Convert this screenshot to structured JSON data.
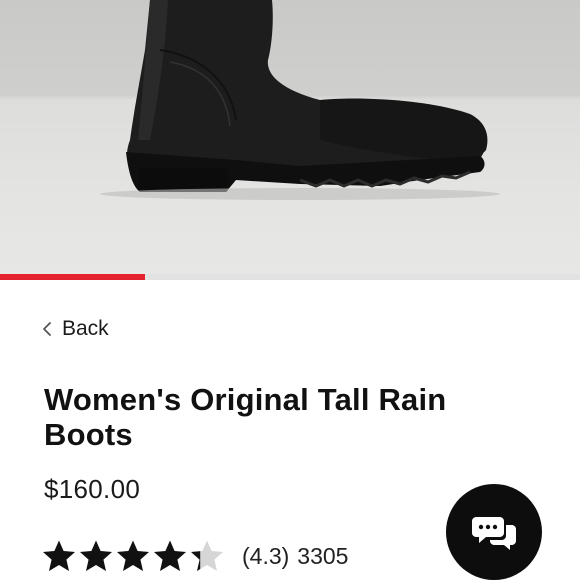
{
  "hero": {
    "image": "black-rain-boot-photo",
    "carousel_progress": 0.25
  },
  "colors": {
    "accent": "#e4232f",
    "chat_button": "#0d0d0d",
    "text": "#111111"
  },
  "nav": {
    "back_label": "Back",
    "back_icon": "chevron-left-icon"
  },
  "product": {
    "title": "Women's Original Tall Rain Boots",
    "price": "$160.00",
    "rating_value": 4.3,
    "rating_max": 5,
    "rating_text": "(4.3)",
    "review_count": "3305"
  },
  "chat": {
    "icon": "chat-bubbles-icon"
  }
}
